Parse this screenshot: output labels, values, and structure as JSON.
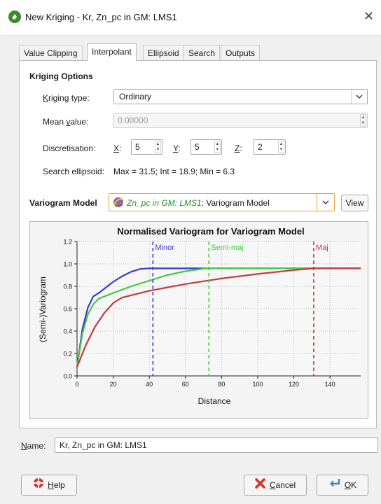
{
  "window": {
    "title": "New Kriging - Kr, Zn_pc in GM: LMS1",
    "close_glyph": "✕"
  },
  "tabs": [
    {
      "label": "Value Clipping",
      "active": false
    },
    {
      "label": "Interpolant",
      "active": true
    },
    {
      "label": "Ellipsoid",
      "active": false
    },
    {
      "label": "Search",
      "active": false
    },
    {
      "label": "Outputs",
      "active": false
    }
  ],
  "kriging": {
    "section_title": "Kriging Options",
    "type_label_hot": "K",
    "type_label_rest": "riging type:",
    "type_value": "Ordinary",
    "mean_label_pre": "Mean ",
    "mean_label_hot": "v",
    "mean_label_rest": "alue:",
    "mean_value": "0.00000",
    "disc_label": "Discretisation:",
    "x_hot": "X",
    "x_rest": ":",
    "x_value": "5",
    "y_hot": "Y",
    "y_rest": ":",
    "y_value": "5",
    "z_hot": "Z",
    "z_rest": ":",
    "z_value": "2",
    "ellipsoid_label": "Search ellipsoid:",
    "ellipsoid_value": "Max = 31.5; Int = 18.9; Min = 6.3"
  },
  "variogram": {
    "label": "Variogram Model",
    "selection_italic": "Zn_pc in GM: LMS1",
    "selection_rest": ": Variogram Model",
    "view_label": "View"
  },
  "chart_data": {
    "type": "line",
    "title": "Normalised Variogram for Variogram Model",
    "xlabel": "Distance",
    "ylabel": "(Semi-)Variogram",
    "xlim": [
      0,
      157
    ],
    "ylim": [
      0,
      1.2
    ],
    "x_ticks": [
      0,
      20,
      40,
      60,
      80,
      100,
      120,
      140
    ],
    "y_ticks": [
      0.0,
      0.2,
      0.4,
      0.6,
      0.8,
      1.0,
      1.2
    ],
    "grid": true,
    "series": [
      {
        "name": "Minor",
        "color": "#3a3acd",
        "x": [
          0,
          3,
          6,
          9,
          12,
          16,
          20,
          25,
          30,
          35,
          40,
          42,
          60,
          80,
          100,
          120,
          140,
          157
        ],
        "y": [
          0.08,
          0.42,
          0.61,
          0.71,
          0.74,
          0.79,
          0.84,
          0.89,
          0.93,
          0.955,
          0.96,
          0.96,
          0.96,
          0.96,
          0.96,
          0.96,
          0.96,
          0.96
        ]
      },
      {
        "name": "Semi-maj",
        "color": "#44c744",
        "x": [
          0,
          3,
          6,
          9,
          12,
          20,
          30,
          40,
          50,
          60,
          70,
          73,
          80,
          100,
          120,
          140,
          157
        ],
        "y": [
          0.08,
          0.38,
          0.55,
          0.64,
          0.69,
          0.74,
          0.8,
          0.85,
          0.9,
          0.935,
          0.957,
          0.96,
          0.96,
          0.96,
          0.96,
          0.96,
          0.96
        ]
      },
      {
        "name": "Maj",
        "color": "#c23b3b",
        "x": [
          0,
          5,
          10,
          15,
          20,
          25,
          40,
          60,
          80,
          100,
          120,
          131,
          140,
          157
        ],
        "y": [
          0.08,
          0.28,
          0.44,
          0.56,
          0.65,
          0.7,
          0.76,
          0.82,
          0.87,
          0.91,
          0.945,
          0.96,
          0.96,
          0.96
        ]
      }
    ],
    "markers": [
      {
        "label": "Minor",
        "x": 42,
        "color": "#3a3acd"
      },
      {
        "label": "Semi-maj",
        "x": 73,
        "color": "#44c744"
      },
      {
        "label": "Maj",
        "x": 131,
        "color": "#c23b3b"
      }
    ]
  },
  "name_field": {
    "label_hot": "N",
    "label_rest": "ame:",
    "value": "Kr, Zn_pc in GM: LMS1"
  },
  "buttons": {
    "help_hot": "H",
    "help_rest": "elp",
    "cancel_hot": "C",
    "cancel_rest": "ancel",
    "ok_hot": "O",
    "ok_rest": "K"
  },
  "icons": {
    "app": "app-logo-icon",
    "variogram": "variogram-model-icon",
    "help": "help-lifebuoy-icon",
    "cancel": "cancel-x-icon",
    "ok": "ok-arrow-icon",
    "dropdown": "chevron-down-icon"
  }
}
